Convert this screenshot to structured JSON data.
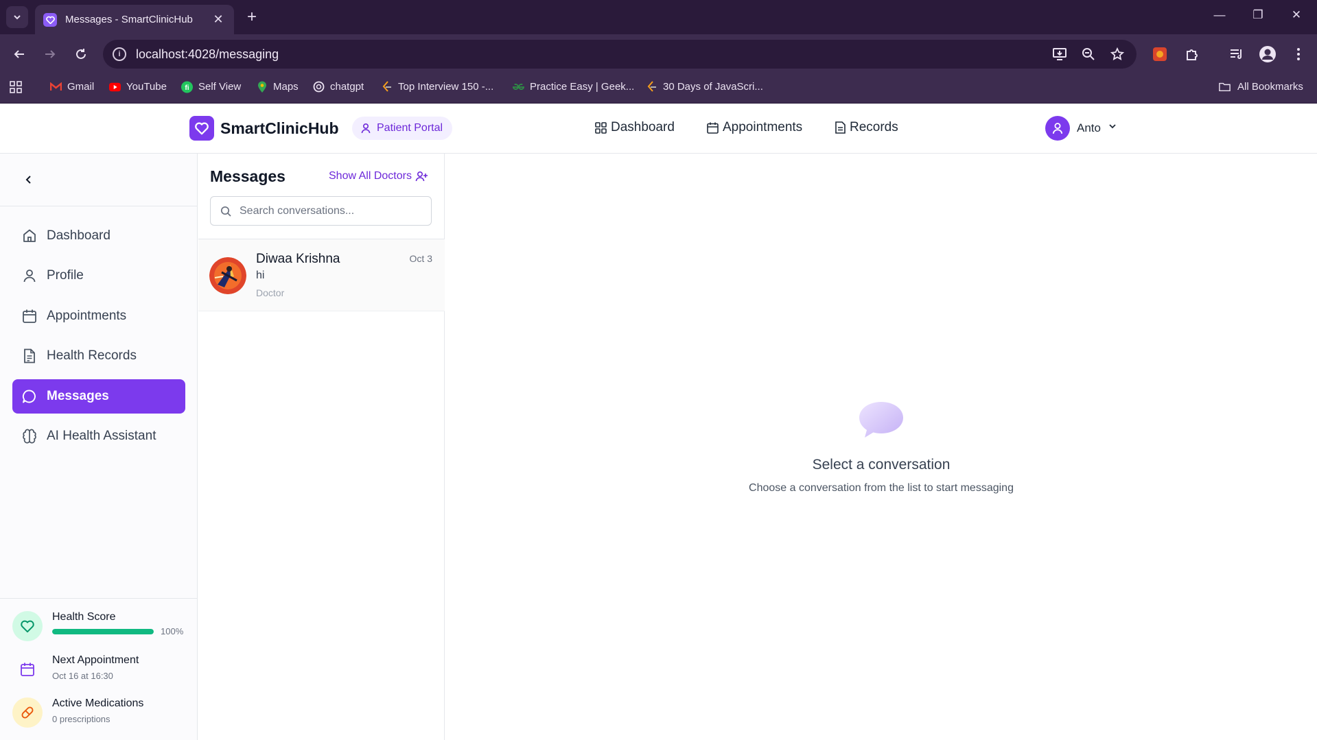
{
  "browser": {
    "tab_title": "Messages - SmartClinicHub",
    "url": "localhost:4028/messaging",
    "bookmarks": [
      {
        "label": "Gmail"
      },
      {
        "label": "YouTube"
      },
      {
        "label": "Self View"
      },
      {
        "label": "Maps"
      },
      {
        "label": "chatgpt"
      },
      {
        "label": "Top Interview 150 -..."
      },
      {
        "label": "Practice Easy | Geek..."
      },
      {
        "label": "30 Days of JavaScri..."
      }
    ],
    "all_bookmarks": "All Bookmarks"
  },
  "header": {
    "brand": "SmartClinicHub",
    "portal": "Patient Portal",
    "nav": [
      {
        "label": "Dashboard"
      },
      {
        "label": "Appointments"
      },
      {
        "label": "Records"
      }
    ],
    "user_name": "Anto"
  },
  "sidebar": {
    "items": [
      {
        "label": "Dashboard",
        "icon": "home-icon"
      },
      {
        "label": "Profile",
        "icon": "user-icon"
      },
      {
        "label": "Appointments",
        "icon": "calendar-icon"
      },
      {
        "label": "Health Records",
        "icon": "document-icon"
      },
      {
        "label": "Messages",
        "icon": "chat-icon",
        "active": true
      },
      {
        "label": "AI Health Assistant",
        "icon": "brain-icon"
      }
    ],
    "stats": {
      "health_score": {
        "title": "Health Score",
        "value": 1.0,
        "label": "100%"
      },
      "next_appointment": {
        "title": "Next Appointment",
        "sub": "Oct 16 at 16:30"
      },
      "active_medications": {
        "title": "Active Medications",
        "sub": "0 prescriptions"
      }
    }
  },
  "conversations": {
    "title": "Messages",
    "show_all": "Show All Doctors",
    "search_placeholder": "Search conversations...",
    "items": [
      {
        "name": "Diwaa Krishna",
        "date": "Oct 3",
        "last_message": "hi",
        "role": "Doctor"
      }
    ]
  },
  "empty_state": {
    "title": "Select a conversation",
    "subtitle": "Choose a conversation from the list to start messaging"
  },
  "colors": {
    "accent": "#7c3aed",
    "chrome_dark": "#2a1a3a",
    "chrome": "#3d2c4f",
    "health_green": "#10b981"
  }
}
